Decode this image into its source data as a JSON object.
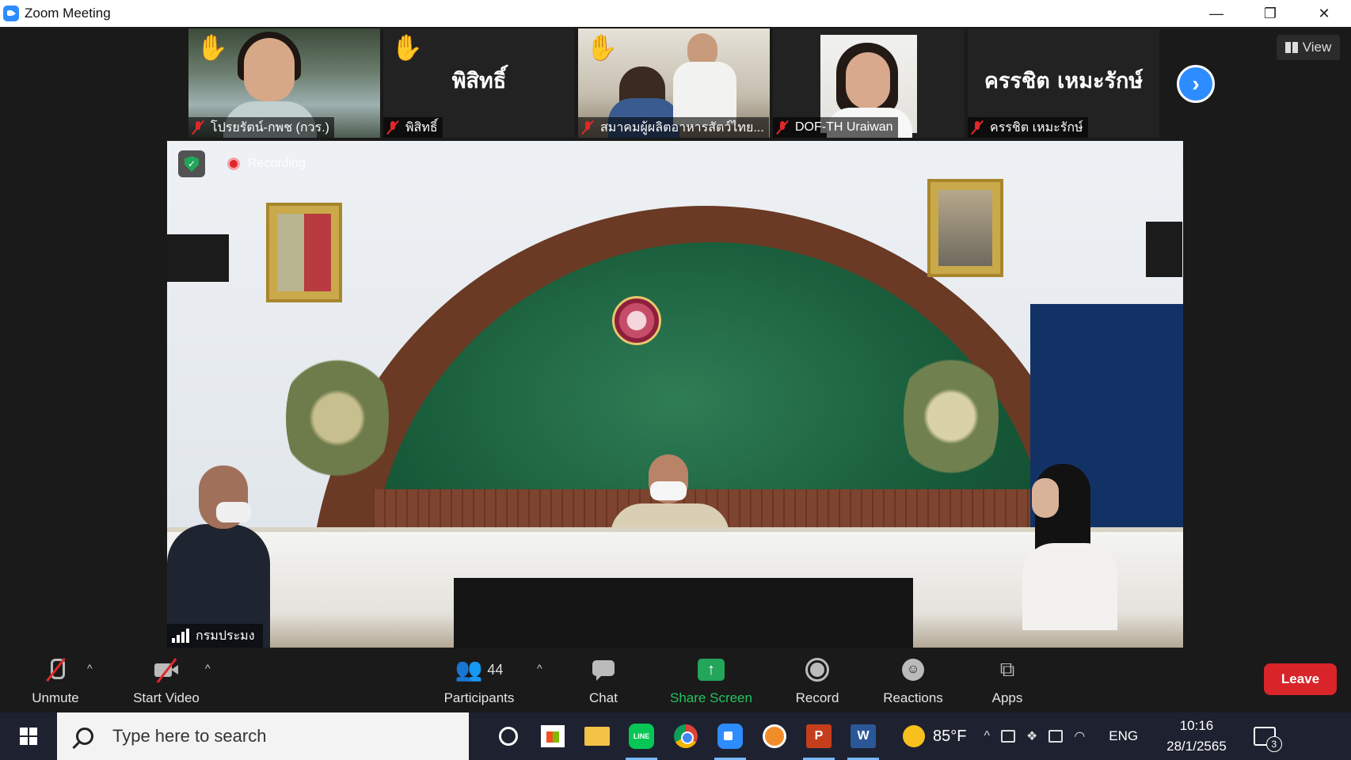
{
  "window": {
    "title": "Zoom Meeting",
    "minimize": "—",
    "restore": "❐",
    "close": "✕"
  },
  "participants_strip": [
    {
      "name": "โปรยรัตน์-กพช (กวร.)",
      "hand_raised": true,
      "muted": true,
      "video": true
    },
    {
      "name": "พิสิทธิ์",
      "display_name": "พิสิทธิ์",
      "hand_raised": true,
      "muted": true,
      "video": false
    },
    {
      "name": "สมาคมผู้ผลิตอาหารสัตว์ไทย...",
      "hand_raised": true,
      "muted": true,
      "video": true
    },
    {
      "name": "DOF-TH Uraiwan",
      "hand_raised": false,
      "muted": true,
      "video": true
    },
    {
      "name": "ครรชิต เหมะรักษ์",
      "display_name": "ครรชิต เหมะรักษ์",
      "hand_raised": false,
      "muted": true,
      "video": false
    }
  ],
  "view_button": "View",
  "next_icon": "chevron-right-icon",
  "main_video": {
    "recording_label": "Recording",
    "speaker_name": "กรมประมง"
  },
  "toolbar": {
    "unmute": "Unmute",
    "start_video": "Start Video",
    "participants": "Participants",
    "participants_count": "44",
    "chat": "Chat",
    "share_screen": "Share Screen",
    "record": "Record",
    "reactions": "Reactions",
    "apps": "Apps",
    "leave": "Leave"
  },
  "taskbar": {
    "search_placeholder": "Type here to search",
    "weather_temp": "85°F",
    "language": "ENG",
    "time": "10:16",
    "date": "28/1/2565",
    "notifications_count": "3",
    "line_label": "LINE",
    "ppt_label": "P",
    "word_label": "W"
  },
  "colors": {
    "accent": "#2d8cff",
    "leave": "#d9242a",
    "share": "#23a55a",
    "muted": "#e02828"
  }
}
